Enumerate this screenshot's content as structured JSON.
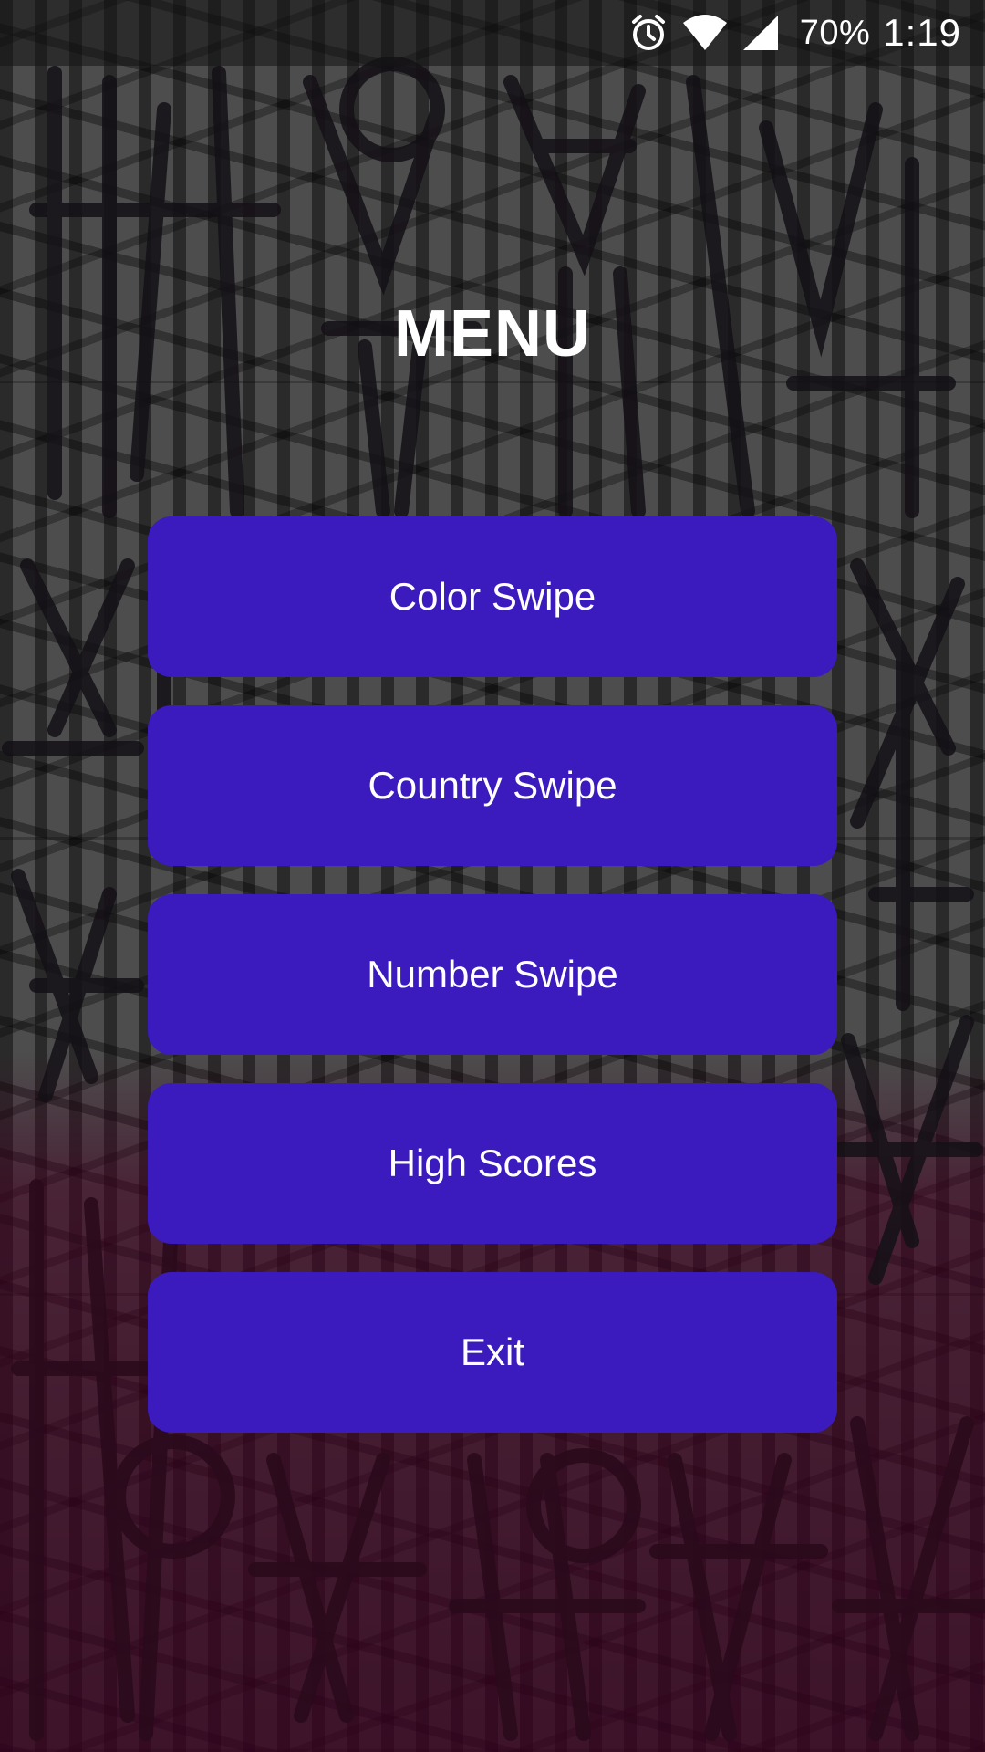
{
  "status_bar": {
    "alarm_icon": "alarm-clock-icon",
    "wifi_icon": "wifi-icon",
    "signal_icon": "cellular-signal-icon",
    "battery": "70%",
    "time": "1:19"
  },
  "menu": {
    "title": "MENU",
    "items": [
      {
        "label": "Color Swipe"
      },
      {
        "label": "Country Swipe"
      },
      {
        "label": "Number Swipe"
      },
      {
        "label": "High Scores"
      },
      {
        "label": "Exit"
      }
    ]
  },
  "colors": {
    "button": "#3b1bbd",
    "text": "#ffffff"
  }
}
